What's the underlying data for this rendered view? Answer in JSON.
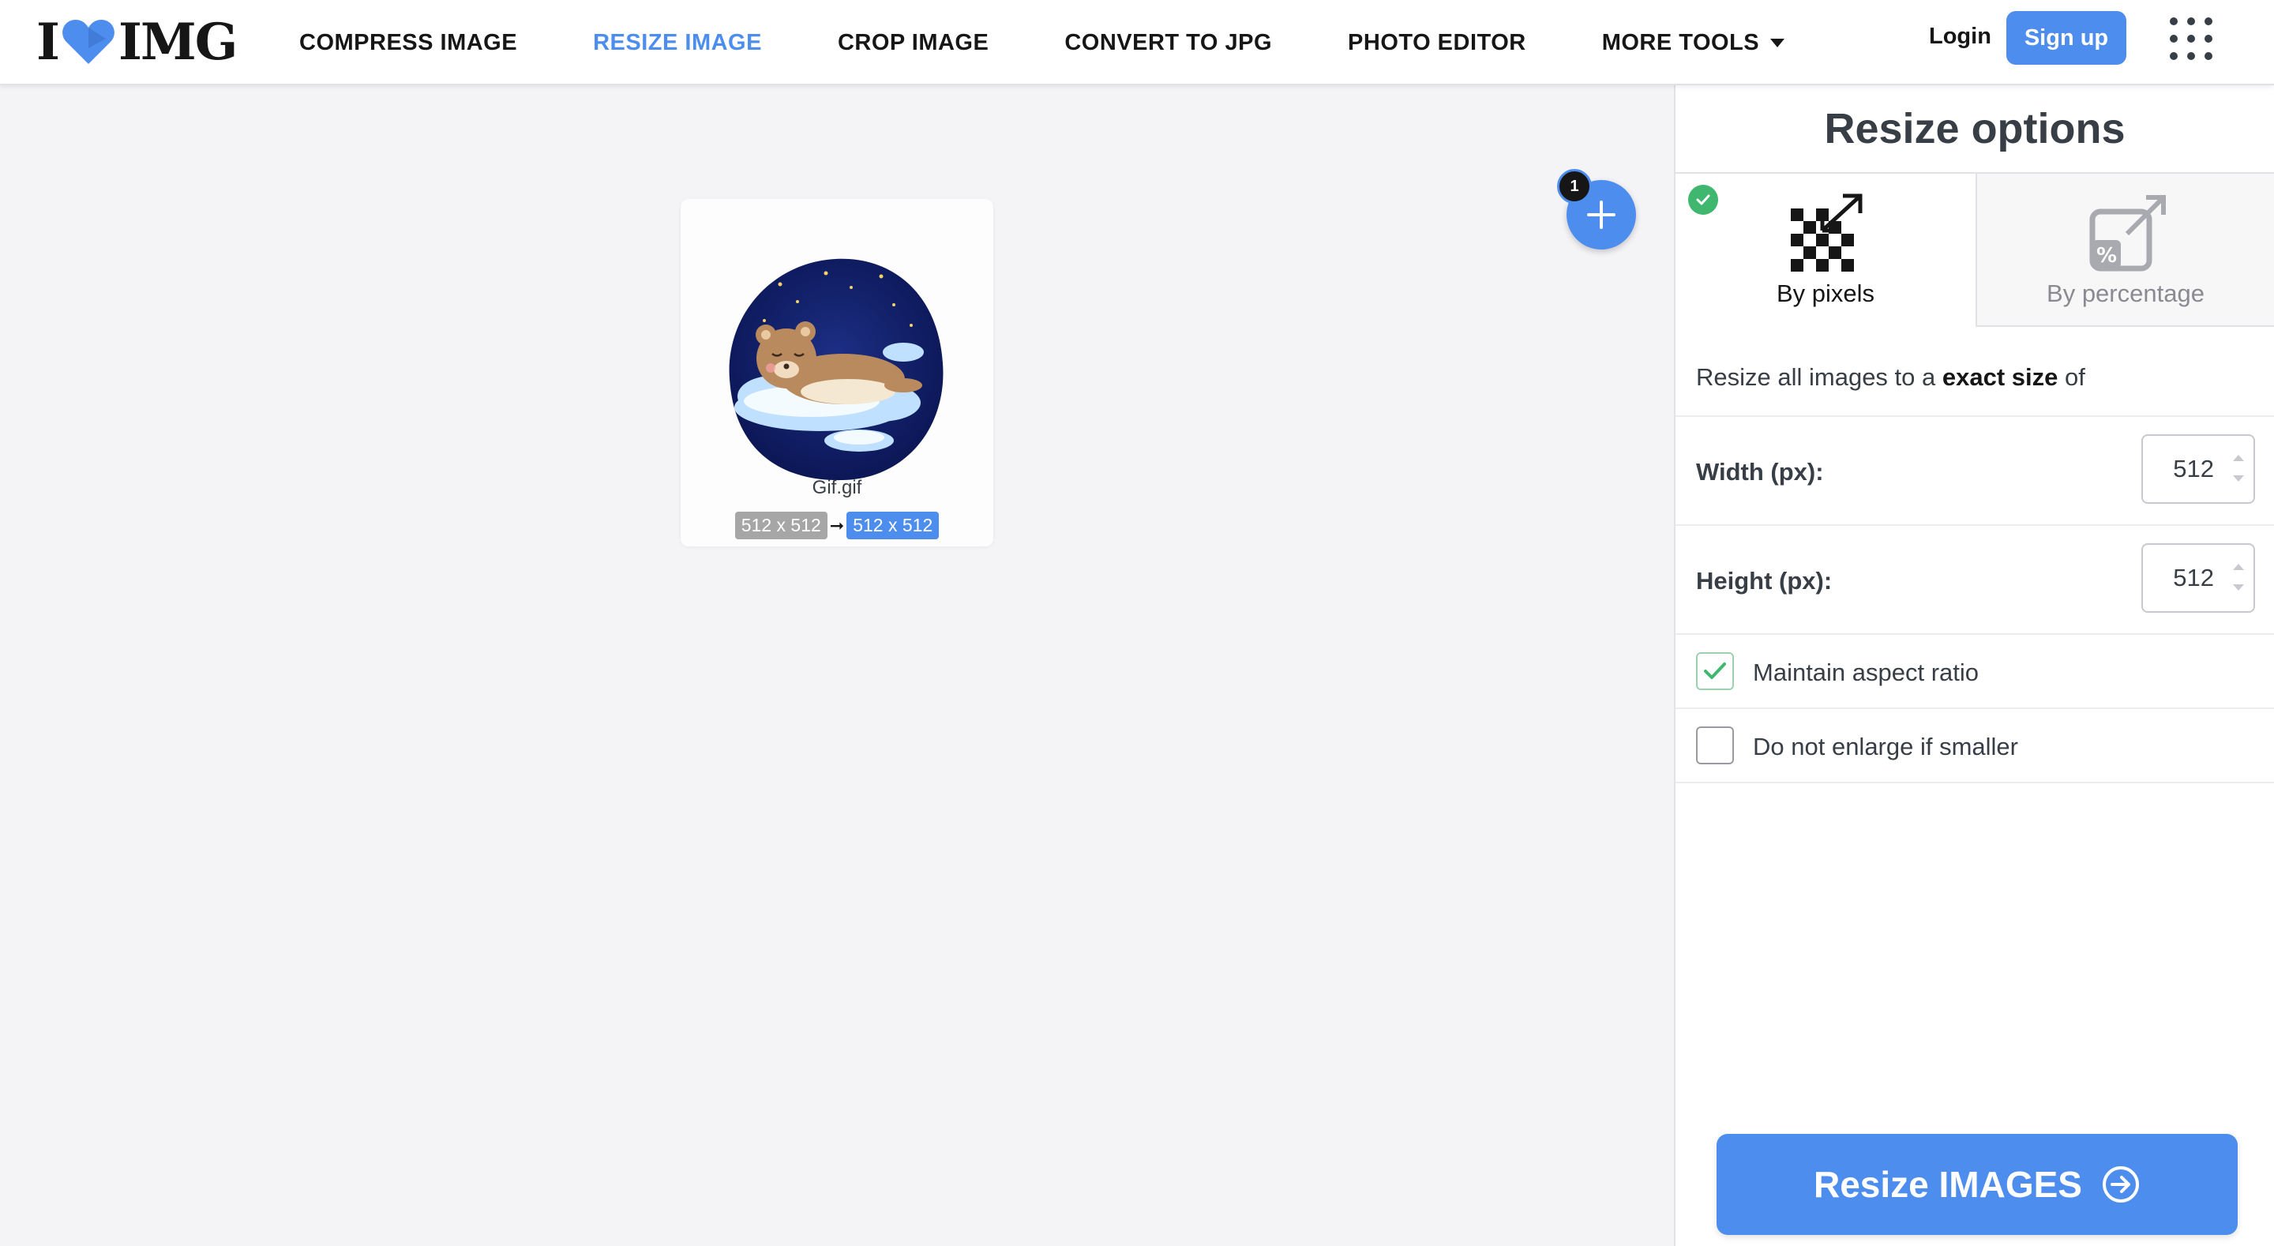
{
  "brand": {
    "logo_left": "I",
    "logo_right": "IMG",
    "accent": "#4d8dee"
  },
  "nav": {
    "items": [
      {
        "label": "COMPRESS IMAGE"
      },
      {
        "label": "RESIZE IMAGE"
      },
      {
        "label": "CROP IMAGE"
      },
      {
        "label": "CONVERT TO JPG"
      },
      {
        "label": "PHOTO EDITOR"
      },
      {
        "label": "MORE TOOLS"
      }
    ],
    "active": "RESIZE IMAGE"
  },
  "auth": {
    "login_label": "Login",
    "signup_label": "Sign up"
  },
  "workarea": {
    "file": {
      "name": "Gif.gif",
      "original_dims": "512 x 512",
      "new_dims": "512 x 512"
    },
    "file_count": "1"
  },
  "sidebar": {
    "title": "Resize options",
    "tabs": [
      {
        "label": "By pixels",
        "selected": true
      },
      {
        "label": "By percentage",
        "selected": false
      }
    ],
    "description": {
      "prefix": "Resize all images to a ",
      "bold": "exact size",
      "suffix": " of"
    },
    "width": {
      "label": "Width (px):",
      "value": "512"
    },
    "height": {
      "label": "Height (px):",
      "value": "512"
    },
    "maintain_aspect": {
      "label": "Maintain aspect ratio",
      "checked": true
    },
    "no_enlarge": {
      "label": "Do not enlarge if smaller",
      "checked": false
    },
    "submit_label": "Resize IMAGES"
  },
  "icons": [
    "heart-logo-icon",
    "caret-down-icon",
    "apps-grid-icon",
    "plus-icon",
    "check-icon",
    "pixels-resize-icon",
    "percentage-resize-icon",
    "arrow-right-circle-icon"
  ],
  "colors": {
    "primary": "#4d8dee",
    "success": "#3fb76e",
    "text": "#161616",
    "muted": "#8a8a93",
    "background": "#f4f4f7"
  }
}
